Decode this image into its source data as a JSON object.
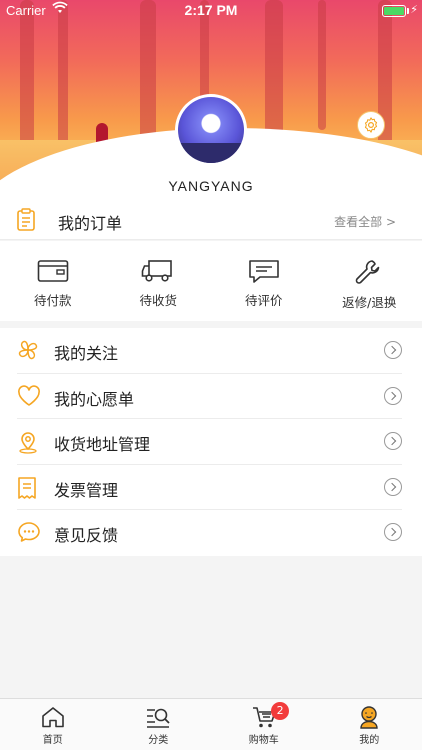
{
  "status_bar": {
    "carrier": "Carrier",
    "time": "2:17 PM"
  },
  "profile": {
    "username": "YANGYANG"
  },
  "orders": {
    "title": "我的订单",
    "view_all": "查看全部 >",
    "items": [
      {
        "label": "待付款",
        "icon": "wallet-icon"
      },
      {
        "label": "待收货",
        "icon": "truck-icon"
      },
      {
        "label": "待评价",
        "icon": "comment-icon"
      },
      {
        "label": "返修/退换",
        "icon": "wrench-icon"
      }
    ]
  },
  "menu": [
    {
      "label": "我的关注",
      "icon": "clover-icon"
    },
    {
      "label": "我的心愿单",
      "icon": "heart-icon"
    },
    {
      "label": "收货地址管理",
      "icon": "location-icon"
    },
    {
      "label": "发票管理",
      "icon": "receipt-icon"
    },
    {
      "label": "意见反馈",
      "icon": "chat-icon"
    }
  ],
  "tabbar": {
    "items": [
      {
        "label": "首页",
        "icon": "home-icon"
      },
      {
        "label": "分类",
        "icon": "category-search-icon"
      },
      {
        "label": "购物车",
        "icon": "cart-icon",
        "badge": "2"
      },
      {
        "label": "我的",
        "icon": "user-icon",
        "active": true
      }
    ]
  },
  "colors": {
    "accent": "#f5a623",
    "badge": "#f23b3b"
  }
}
